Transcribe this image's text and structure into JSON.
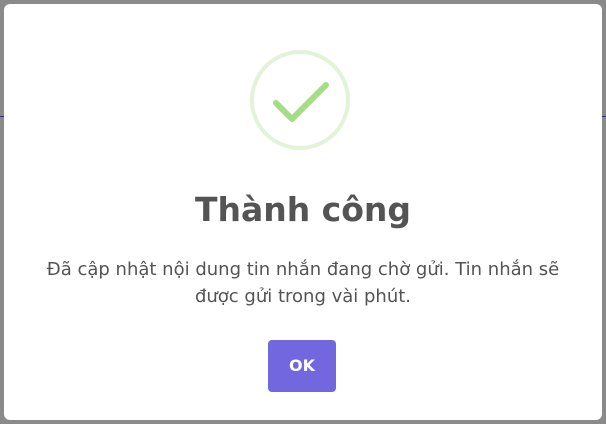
{
  "dialog": {
    "icon": "success-check-icon",
    "title": "Thành công",
    "message": "Đã cập nhật nội dung tin nhắn đang chờ gửi. Tin nhắn sẽ được gửi trong vài phút.",
    "ok_label": "OK"
  },
  "colors": {
    "overlay": "#8a8a8a",
    "dialog_background": "#ffffff",
    "title_text": "#545454",
    "message_text": "#545454",
    "success_ring": "#e3f2d8",
    "success_check": "#a5dc86",
    "ok_button": "#7367e0",
    "ok_button_text": "#ffffff"
  }
}
